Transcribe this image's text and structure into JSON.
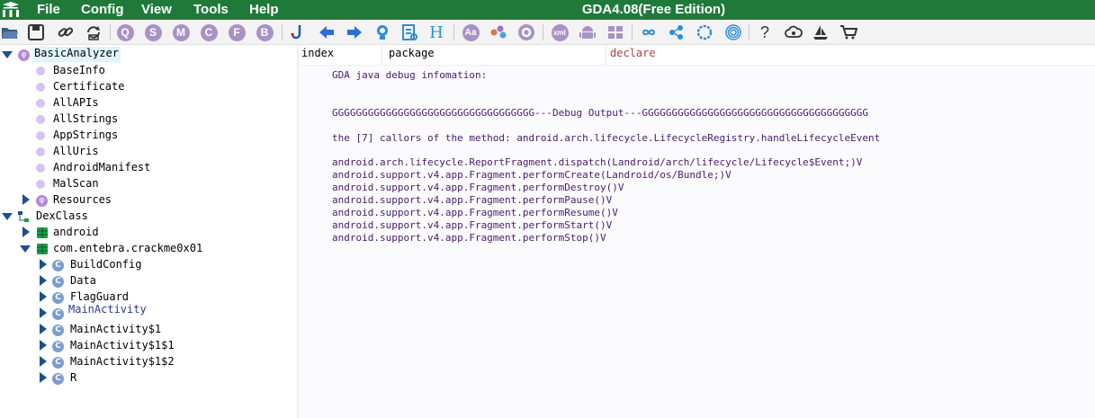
{
  "app": {
    "title": "GDA4.08(Free Edition)",
    "logo_text": "GDA",
    "menu": [
      "File",
      "Config",
      "View",
      "Tools",
      "Help"
    ],
    "colors": {
      "title_bar": "#1f7a3a",
      "tree_triangle": "#1d4f8c",
      "debug_text": "#4b1a6b"
    }
  },
  "toolbar": {
    "icons": [
      "open-folder-icon",
      "save-icon",
      "link-icon",
      "refresh-icon",
      "search-icon",
      "string-search-icon",
      "method-search-icon",
      "class-search-icon",
      "field-search-icon",
      "bytecode-search-icon",
      "jump-icon",
      "back-icon",
      "forward-icon",
      "bulb-icon",
      "decompile-icon",
      "header-icon",
      "font-icon",
      "graph-icon",
      "settings-icon",
      "xml-icon",
      "android-icon",
      "windows-icon",
      "infinity-icon",
      "share-icon",
      "loop-icon",
      "fingerprint-icon",
      "help-icon",
      "cloud-icon",
      "ship-icon",
      "cart-icon"
    ],
    "letters": {
      "search": "Q",
      "string": "S",
      "method": "M",
      "class": "C",
      "field": "F",
      "bytecode": "B",
      "header": "H",
      "font": "Aa",
      "xml": "xml",
      "help": "?"
    }
  },
  "tree": {
    "basic_analyzer": "BasicAnalyzer",
    "basic_children": [
      "BaseInfo",
      "Certificate",
      "AllAPIs",
      "AllStrings",
      "AppStrings",
      "AllUris",
      "AndroidManifest",
      "MalScan"
    ],
    "resources": "Resources",
    "dexclass": "DexClass",
    "packages": [
      "android",
      "com.entebra.crackme0x01"
    ],
    "classes": [
      "BuildConfig",
      "Data",
      "FlagGuard",
      "MainActivity",
      "MainActivity$1",
      "MainActivity$1$1",
      "MainActivity$1$2",
      "R"
    ]
  },
  "columns": [
    "index",
    "package",
    "declare"
  ],
  "output": {
    "heading": "GDA java debug infomation:",
    "separator": "GGGGGGGGGGGGGGGGGGGGGGGGGGGGGGGGGG---Debug Output---GGGGGGGGGGGGGGGGGGGGGGGGGGGGGGGGGGGGGG",
    "callers_title": "the [7] callors of the method: android.arch.lifecycle.LifecycleRegistry.handleLifecycleEvent",
    "callers": [
      "android.arch.lifecycle.ReportFragment.dispatch(Landroid/arch/lifecycle/Lifecycle$Event;)V",
      "android.support.v4.app.Fragment.performCreate(Landroid/os/Bundle;)V",
      "android.support.v4.app.Fragment.performDestroy()V",
      "android.support.v4.app.Fragment.performPause()V",
      "android.support.v4.app.Fragment.performResume()V",
      "android.support.v4.app.Fragment.performStart()V",
      "android.support.v4.app.Fragment.performStop()V"
    ]
  }
}
